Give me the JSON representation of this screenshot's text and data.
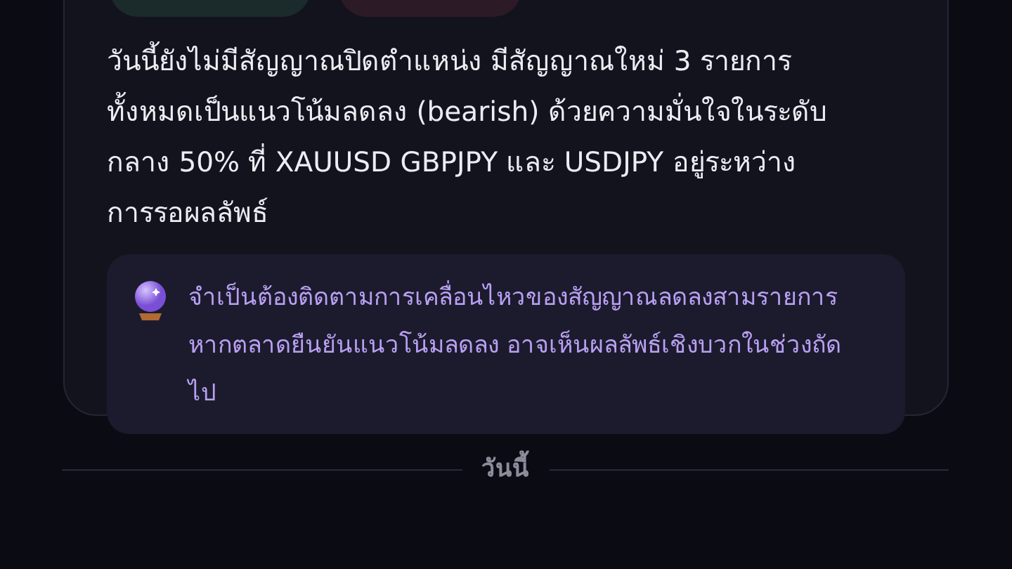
{
  "badges": [
    {
      "color": "#1b2a2a"
    },
    {
      "color": "#2c1a26"
    }
  ],
  "summary": "วันนี้ยังไม่มีสัญญาณปิดตำแหน่ง มีสัญญาณใหม่ 3 รายการทั้งหมดเป็นแนวโน้มลดลง (bearish) ด้วยความมั่นใจในระดับกลาง 50% ที่ XAUUSD GBPJPY และ USDJPY อยู่ระหว่างการรอผลลัพธ์",
  "insight": {
    "text": "จำเป็นต้องติดตามการเคลื่อนไหวของสัญญาณลดลงสามรายการ หากตลาดยืนยันแนวโน้มลดลง อาจเห็นผลลัพธ์เชิงบวกในช่วงถัดไป"
  },
  "divider": {
    "label": "วันนี้"
  }
}
